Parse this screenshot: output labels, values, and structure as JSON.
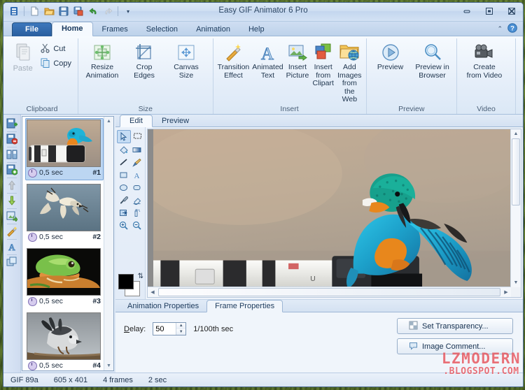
{
  "window": {
    "title": "Easy GIF Animator 6 Pro",
    "quick_access": [
      {
        "name": "app-menu-icon",
        "glyph": "▤"
      },
      {
        "name": "new-icon",
        "glyph": "▯"
      },
      {
        "name": "open-icon",
        "glyph": "📂"
      },
      {
        "name": "save-icon",
        "glyph": "💾"
      },
      {
        "name": "save-as-icon",
        "glyph": "🖫"
      },
      {
        "name": "undo-icon",
        "glyph": "↶"
      },
      {
        "name": "redo-icon",
        "glyph": "↷"
      },
      {
        "name": "customize-qat-icon",
        "glyph": "▾"
      }
    ],
    "controls": {
      "minimize": "—",
      "maximize": "❐",
      "close": "✕"
    },
    "help_icons": {
      "collapse_ribbon": "⌃",
      "help": "?"
    }
  },
  "ribbon": {
    "tabs": [
      {
        "label": "File",
        "type": "file"
      },
      {
        "label": "Home",
        "active": true
      },
      {
        "label": "Frames"
      },
      {
        "label": "Selection"
      },
      {
        "label": "Animation"
      },
      {
        "label": "Help"
      }
    ],
    "groups": [
      {
        "label": "Clipboard",
        "paste": {
          "label": "Paste",
          "icon": "paste-icon",
          "disabled": true
        },
        "small": [
          {
            "label": "Cut",
            "icon": "cut-icon"
          },
          {
            "label": "Copy",
            "icon": "copy-icon"
          }
        ]
      },
      {
        "label": "Size",
        "buttons": [
          {
            "label": "Resize\nAnimation",
            "line1": "Resize",
            "line2": "Animation",
            "icon": "resize-animation-icon"
          },
          {
            "label": "Crop Edges",
            "line1": "Crop",
            "line2": "Edges",
            "icon": "crop-edges-icon"
          },
          {
            "label": "Canvas Size",
            "line1": "Canvas",
            "line2": "Size",
            "icon": "canvas-size-icon"
          }
        ]
      },
      {
        "label": "Insert",
        "buttons": [
          {
            "line1": "Transition",
            "line2": "Effect",
            "icon": "transition-effect-icon"
          },
          {
            "line1": "Animated",
            "line2": "Text",
            "icon": "animated-text-icon"
          },
          {
            "line1": "Insert",
            "line2": "Picture",
            "icon": "insert-picture-icon"
          },
          {
            "line1": "Insert from",
            "line2": "Clipart",
            "icon": "insert-clipart-icon"
          },
          {
            "line1": "Add Images",
            "line2": "from the Web",
            "icon": "add-images-web-icon"
          }
        ]
      },
      {
        "label": "Preview",
        "buttons": [
          {
            "line1": "Preview",
            "line2": "",
            "icon": "preview-icon"
          },
          {
            "line1": "Preview in",
            "line2": "Browser",
            "icon": "preview-browser-icon"
          }
        ]
      },
      {
        "label": "Video",
        "buttons": [
          {
            "line1": "Create",
            "line2": "from Video",
            "icon": "create-from-video-icon"
          }
        ]
      }
    ]
  },
  "frames_panel": {
    "tools": [
      {
        "name": "add-frame-icon"
      },
      {
        "name": "delete-frame-icon"
      },
      {
        "name": "duplicate-frame-icon"
      },
      {
        "name": "insert-frame-icon"
      },
      {
        "name": "move-frame-up-icon"
      },
      {
        "name": "move-frame-down-icon"
      },
      {
        "name": "edit-frame-icon"
      },
      {
        "name": "effects-icon"
      },
      {
        "name": "text-tool-icon"
      },
      {
        "name": "overlay-icon"
      }
    ],
    "frames": [
      {
        "duration": "0,5 sec",
        "number": "#1",
        "selected": true,
        "subject": "kingfisher-on-lens"
      },
      {
        "duration": "0,5 sec",
        "number": "#2",
        "selected": false,
        "subject": "flying-bird"
      },
      {
        "duration": "0,5 sec",
        "number": "#3",
        "selected": false,
        "subject": "tree-frog"
      },
      {
        "duration": "0,5 sec",
        "number": "#4",
        "selected": false,
        "subject": "bird-on-branch"
      }
    ]
  },
  "edit_area": {
    "tabs": [
      {
        "label": "Edit",
        "active": true
      },
      {
        "label": "Preview",
        "active": false
      }
    ],
    "tools": [
      {
        "name": "pointer-tool-icon",
        "selected": true
      },
      {
        "name": "marquee-select-tool-icon",
        "selected": false
      },
      {
        "name": "fill-bucket-tool-icon",
        "selected": false
      },
      {
        "name": "gradient-tool-icon",
        "selected": false
      },
      {
        "name": "line-tool-icon",
        "selected": false
      },
      {
        "name": "brush-tool-icon",
        "selected": false
      },
      {
        "name": "rectangle-tool-icon",
        "selected": false
      },
      {
        "name": "text-tool-icon",
        "selected": false
      },
      {
        "name": "ellipse-tool-icon",
        "selected": false
      },
      {
        "name": "rounded-rect-tool-icon",
        "selected": false
      },
      {
        "name": "eyedropper-tool-icon",
        "selected": false
      },
      {
        "name": "eraser-tool-icon",
        "selected": false
      },
      {
        "name": "transform-tool-icon",
        "selected": false
      },
      {
        "name": "spray-tool-icon",
        "selected": false
      },
      {
        "name": "zoom-in-tool-icon",
        "selected": false
      },
      {
        "name": "zoom-out-tool-icon",
        "selected": false
      }
    ],
    "colors": {
      "foreground": "#000000",
      "background": "#ffffff",
      "swap_icon": "swap-colors-icon"
    },
    "canvas_subject": "kingfisher-preening-on-camera-lens"
  },
  "properties": {
    "tabs": [
      {
        "label": "Animation Properties",
        "active": false
      },
      {
        "label": "Frame Properties",
        "active": true
      }
    ],
    "delay": {
      "label": "Delay:",
      "value": "50",
      "units": "1/100th sec"
    },
    "buttons": [
      {
        "label": "Set Transparency...",
        "icon": "transparency-icon"
      },
      {
        "label": "Image Comment...",
        "icon": "comment-icon"
      }
    ]
  },
  "status_bar": {
    "format": "GIF 89a",
    "dimensions": "605 x 401",
    "frame_count": "4 frames",
    "total_duration": "2 sec"
  },
  "watermark": {
    "line1": "LZMODERN",
    "line2": ".BLOGSPOT.COM",
    "color": "#e7545c"
  }
}
